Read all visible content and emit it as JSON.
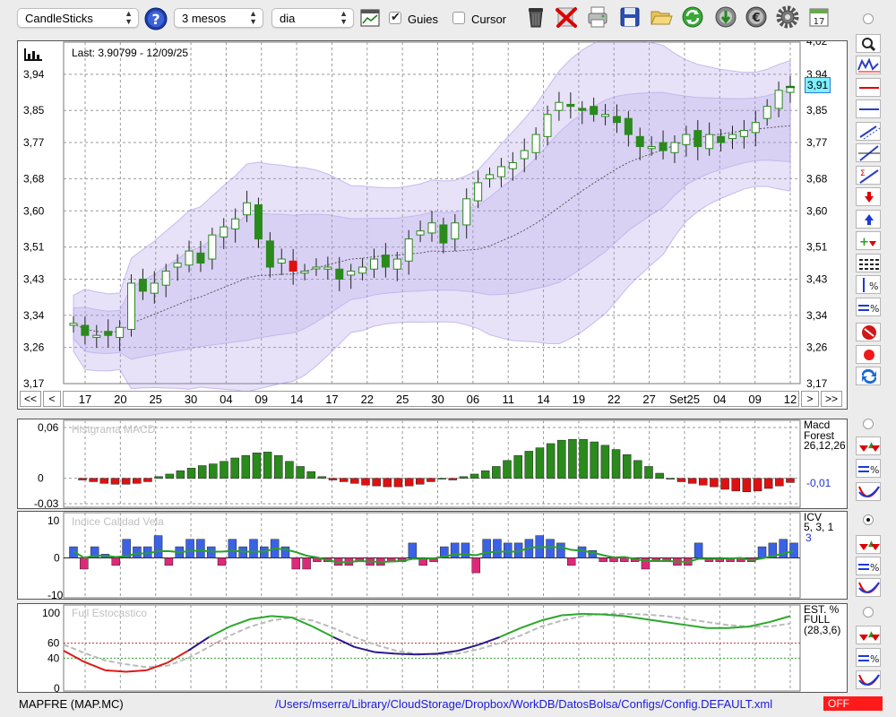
{
  "toolbar": {
    "chart_type": "CandleSticks",
    "period": "3 mesos",
    "interval": "dia",
    "guides_label": "Guies",
    "guides_checked": true,
    "cursor_label": "Cursor",
    "cursor_checked": false,
    "calendar_day": "17",
    "icons": [
      "help-icon",
      "indicator-icon",
      "trash-icon",
      "delete-icon",
      "print-icon",
      "save-icon",
      "open-folder-icon",
      "refresh-icon",
      "download-icon",
      "currency-icon",
      "settings-icon",
      "calendar-icon"
    ]
  },
  "main_chart": {
    "last_label": "Last: 3.90799 - 12/09/25",
    "current_price_tag": "3,91",
    "y_ticks": [
      "3,94",
      "3,85",
      "3,77",
      "3,68",
      "3,60",
      "3,51",
      "3,43",
      "3,34",
      "3,26",
      "3,17"
    ],
    "y_top_partial": "4,02",
    "x_ticks": [
      "17",
      "20",
      "25",
      "30",
      "04",
      "09",
      "14",
      "17",
      "22",
      "25",
      "30",
      "06",
      "11",
      "14",
      "19",
      "22",
      "27",
      "Set25",
      "04",
      "09",
      "12"
    ],
    "nav_buttons": [
      "<<",
      "<",
      ">",
      ">>"
    ]
  },
  "macd": {
    "title": "Histgrama MACD",
    "label_line1": "Macd",
    "label_line2": "Forest",
    "params": "26,12,26",
    "value": "-0,01",
    "y_ticks": [
      "0,06",
      "0",
      "-0,03"
    ]
  },
  "icv": {
    "title": "Indice Calidad Vela",
    "label": "ICV",
    "params": "5, 3, 1",
    "value": "3",
    "y_ticks": [
      "10",
      "0",
      "-10"
    ]
  },
  "stoch": {
    "title": "Full Estocastico",
    "label_line1": "EST. %",
    "label_line2": "FULL",
    "params": "(28,3,6)",
    "y_ticks": [
      "100",
      "60",
      "40",
      "0"
    ]
  },
  "status": {
    "ticker": "MAPFRE (MAP.MC)",
    "path": "/Users/mserra/Library/CloudStorage/Dropbox/WorkDB/DatosBolsa/Configs/Config.DEFAULT.xml",
    "connection": "OFF"
  },
  "colors": {
    "up": "#2a8a1c",
    "down": "#e01010",
    "band": "#a897e6",
    "blue_bar": "#3b62e6",
    "pink_bar": "#e0287a",
    "status_off": "#ff1a1a"
  },
  "chart_data": [
    {
      "type": "candlestick",
      "title": "",
      "ylim": [
        3.17,
        4.02
      ],
      "x_ticks": [
        "17",
        "20",
        "25",
        "30",
        "04",
        "09",
        "14",
        "17",
        "22",
        "25",
        "30",
        "06",
        "11",
        "14",
        "19",
        "22",
        "27",
        "Set25",
        "04",
        "09",
        "12"
      ],
      "last_close": 3.90799,
      "candles_close": [
        3.32,
        3.29,
        3.29,
        3.29,
        3.31,
        3.42,
        3.4,
        3.42,
        3.45,
        3.47,
        3.5,
        3.47,
        3.54,
        3.56,
        3.58,
        3.62,
        3.53,
        3.46,
        3.48,
        3.45,
        3.45,
        3.46,
        3.46,
        3.43,
        3.45,
        3.46,
        3.48,
        3.46,
        3.48,
        3.53,
        3.55,
        3.57,
        3.52,
        3.57,
        3.63,
        3.67,
        3.69,
        3.71,
        3.72,
        3.75,
        3.79,
        3.84,
        3.87,
        3.86,
        3.85,
        3.84,
        3.84,
        3.82,
        3.79,
        3.76,
        3.76,
        3.75,
        3.77,
        3.79,
        3.76,
        3.79,
        3.77,
        3.79,
        3.8,
        3.82,
        3.86,
        3.9,
        3.91
      ]
    },
    {
      "type": "bar",
      "title": "Histgrama MACD",
      "ylim": [
        -0.03,
        0.06
      ],
      "values": [
        -0.002,
        -0.004,
        -0.006,
        -0.007,
        -0.007,
        -0.006,
        -0.004,
        0.002,
        0.005,
        0.009,
        0.012,
        0.015,
        0.017,
        0.02,
        0.024,
        0.027,
        0.03,
        0.031,
        0.027,
        0.02,
        0.014,
        0.008,
        0.002,
        -0.002,
        -0.004,
        -0.006,
        -0.008,
        -0.009,
        -0.01,
        -0.01,
        -0.009,
        -0.007,
        -0.004,
        0.0,
        -0.002,
        0.002,
        0.005,
        0.009,
        0.014,
        0.021,
        0.027,
        0.032,
        0.036,
        0.041,
        0.045,
        0.046,
        0.046,
        0.043,
        0.039,
        0.034,
        0.028,
        0.021,
        0.014,
        0.006,
        0.0,
        -0.004,
        -0.006,
        -0.008,
        -0.01,
        -0.013,
        -0.015,
        -0.016,
        -0.015,
        -0.012,
        -0.009,
        -0.005
      ]
    },
    {
      "type": "bar",
      "title": "Indice Calidad Vela",
      "ylim": [
        -10,
        10
      ],
      "values": [
        3,
        -3,
        3,
        1,
        -2,
        5,
        3,
        3,
        6,
        -2,
        3,
        5,
        5,
        3,
        -2,
        5,
        3,
        5,
        3,
        5,
        3,
        -3,
        -3,
        -1,
        -1,
        -2,
        -2,
        -1,
        -2,
        -2,
        -1,
        -1,
        4,
        -2,
        -1,
        3,
        4,
        4,
        -4,
        5,
        5,
        4,
        4,
        5,
        6,
        5,
        4,
        -2,
        3,
        2,
        -1,
        -1,
        -1,
        -1,
        -3,
        -1,
        -1,
        -2,
        -2,
        4,
        -1,
        -1,
        -1,
        -1,
        -1,
        3,
        4,
        5,
        4
      ]
    },
    {
      "type": "line",
      "title": "Full Estocastico",
      "ylim": [
        0,
        100
      ],
      "series": [
        {
          "values": [
            50,
            35,
            24,
            22,
            24,
            34,
            50,
            68,
            82,
            92,
            96,
            94,
            82,
            68,
            55,
            48,
            46,
            45,
            46,
            50,
            58,
            68,
            80,
            90,
            97,
            99,
            98,
            96,
            92,
            88,
            84,
            80,
            80,
            82,
            88,
            96
          ]
        },
        {
          "values": [
            58,
            47,
            37,
            32,
            28,
            30,
            40,
            55,
            70,
            82,
            90,
            94,
            90,
            80,
            68,
            58,
            50,
            46,
            45,
            46,
            52,
            60,
            70,
            82,
            90,
            96,
            99,
            99,
            98,
            96,
            92,
            88,
            84,
            82,
            82,
            86
          ]
        }
      ]
    }
  ]
}
